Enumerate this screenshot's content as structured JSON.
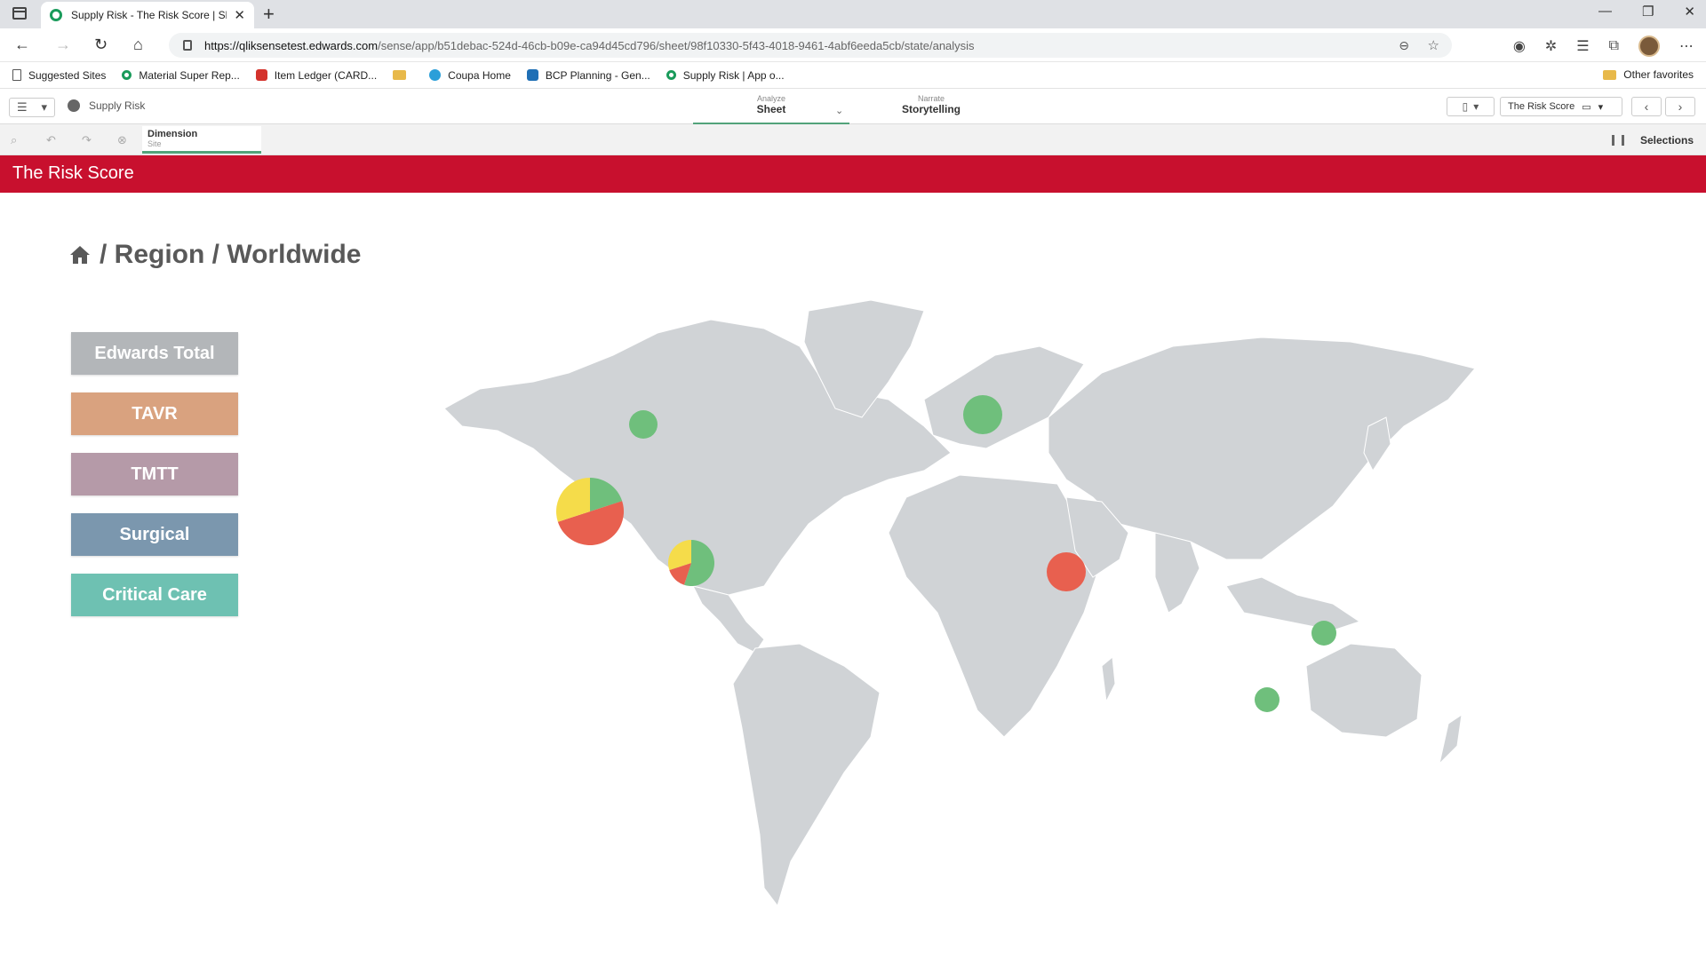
{
  "browser": {
    "tab_title": "Supply Risk - The Risk Score | Sh",
    "url_host": "https://qliksensetest.edwards.com",
    "url_path": "/sense/app/b51debac-524d-46cb-b09e-ca94d45cd796/sheet/98f10330-5f43-4018-9461-4abf6eeda5cb/state/analysis",
    "bookmarks": [
      "Suggested Sites",
      "Material Super Rep...",
      "Item Ledger (CARD...",
      "",
      "Coupa Home",
      "BCP Planning - Gen...",
      "Supply Risk | App o..."
    ],
    "other_favorites": "Other favorites"
  },
  "qlik": {
    "app_name": "Supply Risk",
    "analyze_small": "Analyze",
    "analyze_main": "Sheet",
    "narrate_small": "Narrate",
    "narrate_main": "Storytelling",
    "sheet_name": "The Risk Score",
    "dimension_label": "Dimension",
    "dimension_value": "Site",
    "selections_label": "Selections"
  },
  "sheet": {
    "header_title": "The Risk Score",
    "breadcrumb": "/ Region / Worldwide",
    "buttons": [
      {
        "label": "Edwards Total"
      },
      {
        "label": "TAVR"
      },
      {
        "label": "TMTT"
      },
      {
        "label": "Surgical"
      },
      {
        "label": "Critical Care"
      }
    ]
  },
  "colors": {
    "header_red": "#c8102e",
    "risk_green": "#6fbf7c",
    "risk_yellow": "#f5dc4a",
    "risk_red": "#e8604f",
    "land_gray": "#d0d3d6"
  },
  "map_markers": [
    {
      "location": "Central North America",
      "shares": {
        "green": 1.0
      }
    },
    {
      "location": "Western USA / Mexico",
      "shares": {
        "green": 0.2,
        "red": 0.5,
        "yellow": 0.3
      }
    },
    {
      "location": "Central America",
      "shares": {
        "green": 0.55,
        "red": 0.15,
        "yellow": 0.3
      }
    },
    {
      "location": "Western Europe",
      "shares": {
        "green": 1.0
      }
    },
    {
      "location": "Middle East",
      "shares": {
        "red": 1.0
      }
    },
    {
      "location": "Philippines",
      "shares": {
        "green": 1.0
      }
    },
    {
      "location": "Singapore",
      "shares": {
        "green": 1.0
      }
    }
  ]
}
